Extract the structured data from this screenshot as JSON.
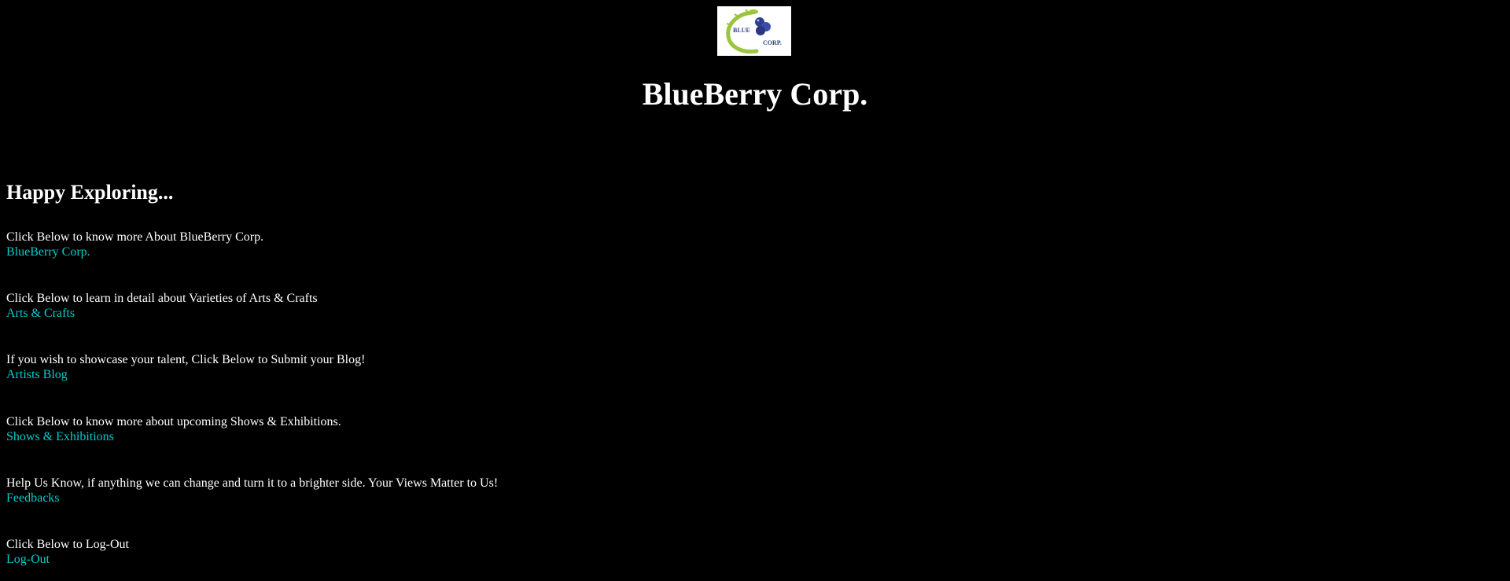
{
  "header": {
    "logo_top_text": "BLUE",
    "logo_bottom_text": "CORP.",
    "title": "BlueBerry Corp."
  },
  "main": {
    "greeting": "Happy Exploring...",
    "sections": [
      {
        "description": "Click Below to know more About BlueBerry Corp.",
        "link": "BlueBerry Corp."
      },
      {
        "description": "Click Below to learn in detail about Varieties of Arts & Crafts",
        "link": "Arts & Crafts"
      },
      {
        "description": "If you wish to showcase your talent, Click Below to Submit your Blog!",
        "link": "Artists Blog"
      },
      {
        "description": "Click Below to know more about upcoming Shows & Exhibitions.",
        "link": "Shows & Exhibitions"
      },
      {
        "description": "Help Us Know, if anything we can change and turn it to a brighter side. Your Views Matter to Us!",
        "link": "Feedbacks"
      },
      {
        "description": "Click Below to Log-Out",
        "link": "Log-Out"
      }
    ]
  },
  "colors": {
    "background": "#000000",
    "text": "#ffffff",
    "link": "#00cccc",
    "logo_green": "#9bc53d",
    "logo_berry": "#2f3f8f"
  }
}
